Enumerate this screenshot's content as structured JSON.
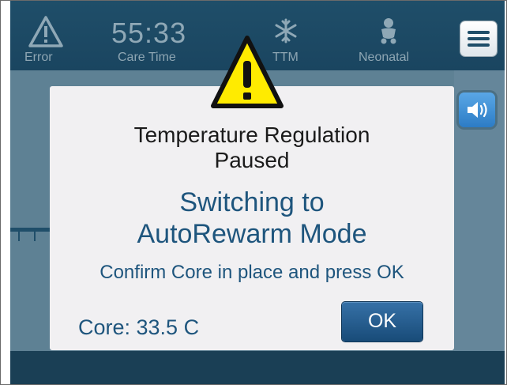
{
  "status_bar": {
    "error_label": "Error",
    "care_time_value": "55:33",
    "care_time_label": "Care Time",
    "ttm_label": "TTM",
    "patient_label": "Neonatal"
  },
  "dialog": {
    "title_line1": "Temperature Regulation",
    "title_line2": "Paused",
    "switching_line1": "Switching to",
    "switching_line2": "AutoRewarm Mode",
    "instruction": "Confirm Core in place and press OK",
    "core_reading": "Core: 33.5 C",
    "ok_label": "OK"
  },
  "colors": {
    "header": "#1f4e69",
    "screen_background": "#5e8194",
    "dialog_background": "#f1f0f2",
    "dialog_text_blue": "#1e557d",
    "warning_yellow": "#ffeb00",
    "ok_button": "#265f93",
    "sound_button": "#3d8bd3"
  },
  "icons": [
    "error-warning-icon",
    "snowflake-icon",
    "baby-icon",
    "menu-icon",
    "speaker-icon",
    "large-warning-icon"
  ]
}
